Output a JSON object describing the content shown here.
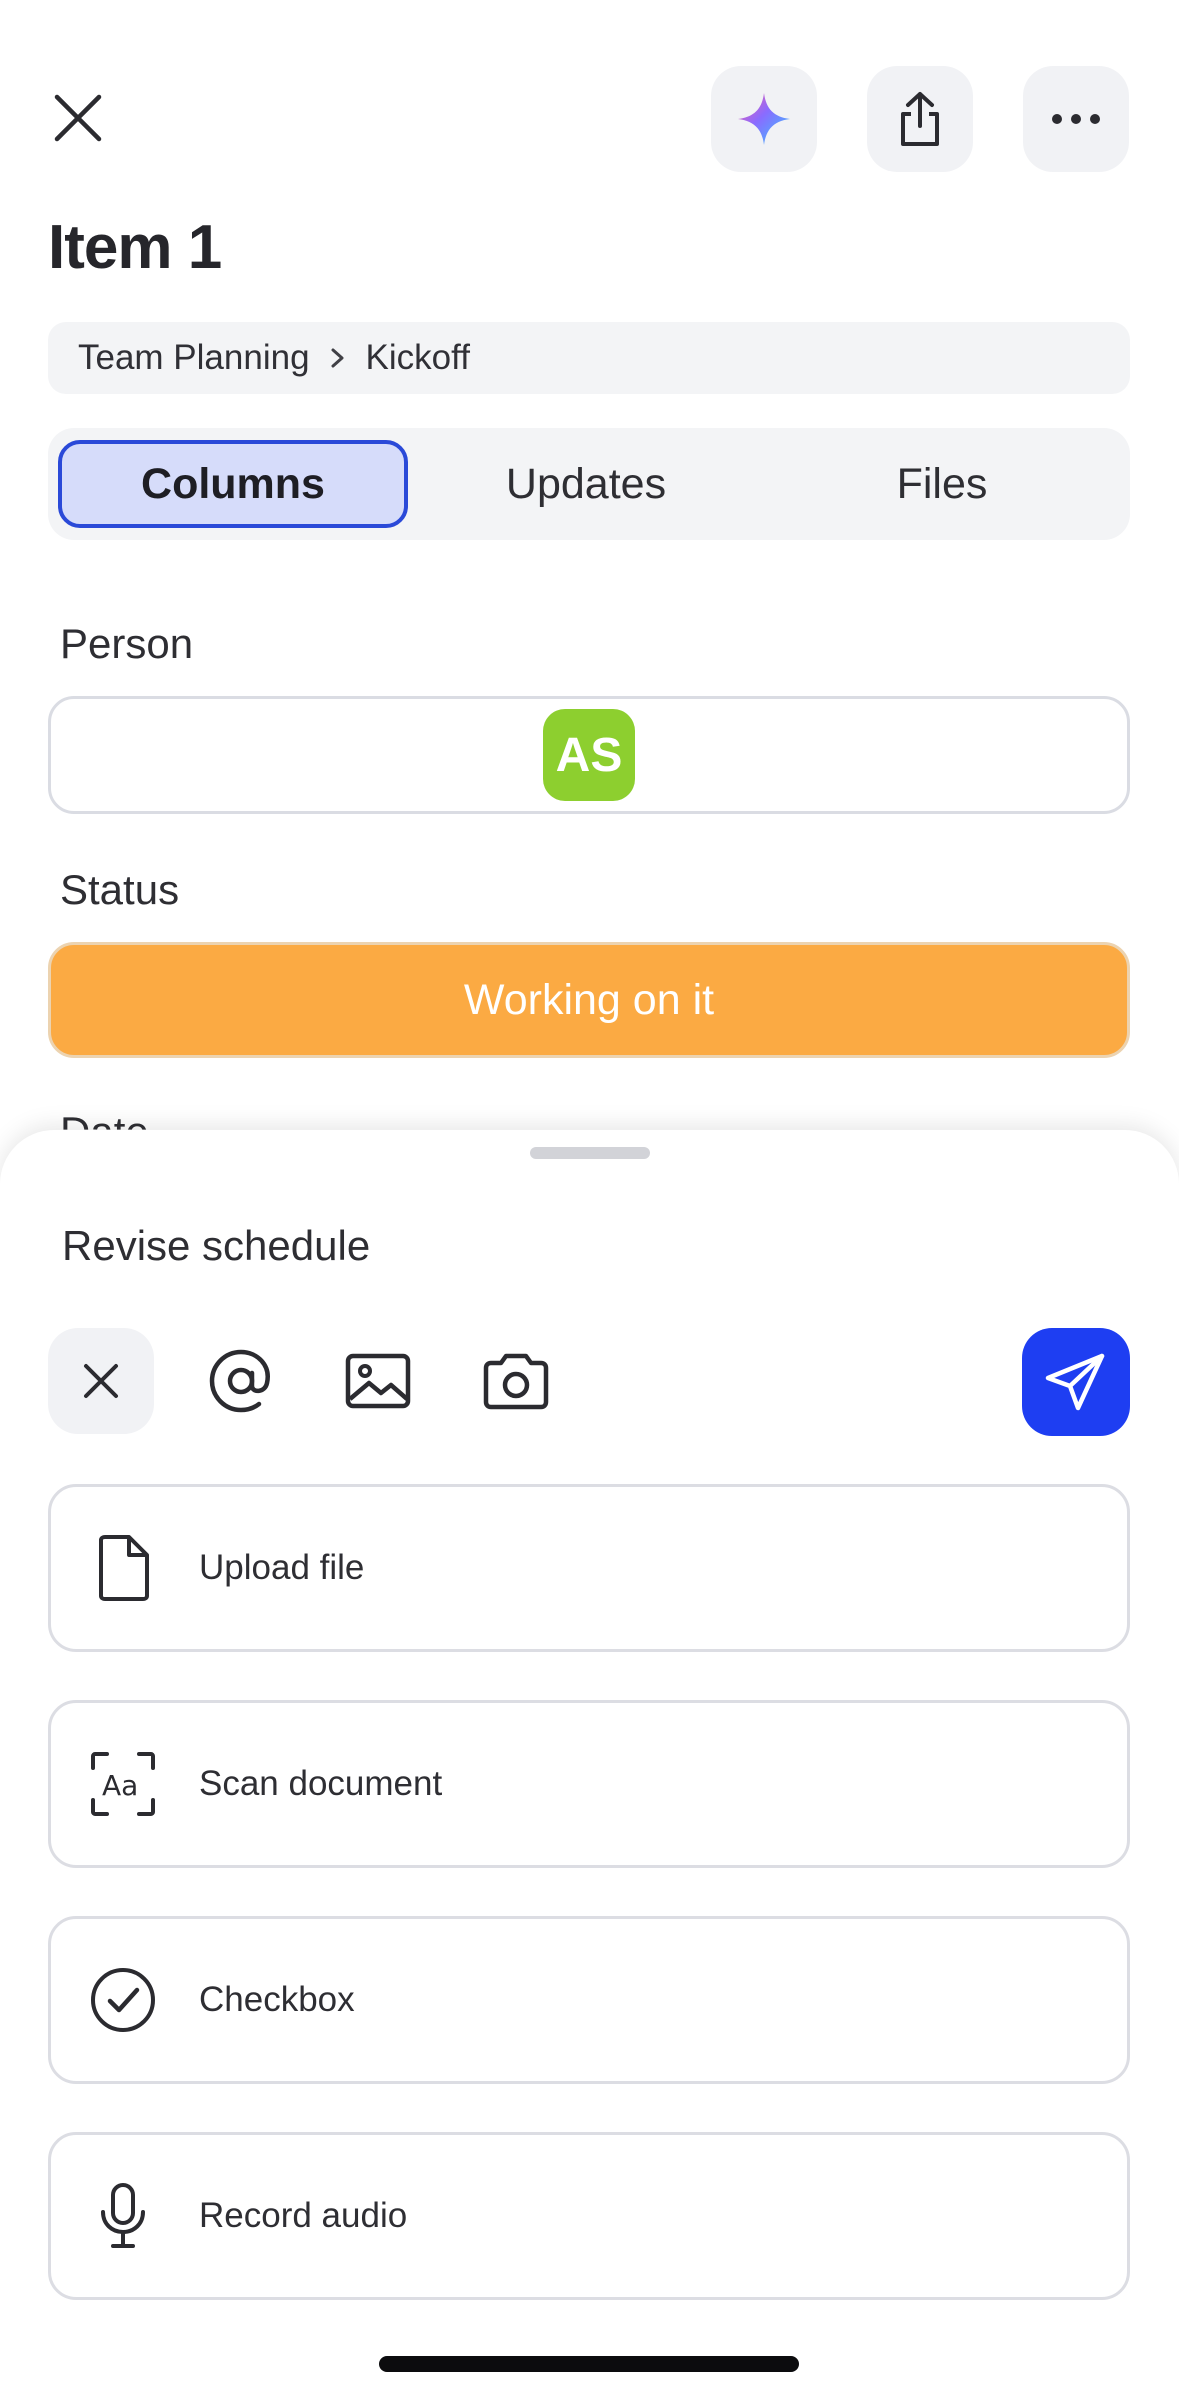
{
  "header": {
    "title": "Item 1",
    "icons": {
      "close": "close-icon",
      "ai": "sparkle-icon",
      "share": "share-icon",
      "more": "more-horizontal-icon"
    }
  },
  "breadcrumb": {
    "items": [
      "Team Planning",
      "Kickoff"
    ]
  },
  "tabs": [
    {
      "label": "Columns",
      "active": true
    },
    {
      "label": "Updates",
      "active": false
    },
    {
      "label": "Files",
      "active": false
    }
  ],
  "columns": {
    "person": {
      "label": "Person",
      "avatar_initials": "AS",
      "avatar_color": "#8dcf2f"
    },
    "status": {
      "label": "Status",
      "value": "Working on it",
      "color": "#fbaa43"
    },
    "date": {
      "label": "Date"
    }
  },
  "sheet": {
    "input_text": "Revise schedule",
    "toolbar": {
      "icons": [
        "close-icon",
        "mention-icon",
        "image-icon",
        "camera-icon"
      ],
      "send_icon": "send-icon",
      "send_color": "#1e3ef2"
    },
    "options": [
      {
        "label": "Upload file",
        "icon": "file-icon"
      },
      {
        "label": "Scan document",
        "icon": "scan-document-icon"
      },
      {
        "label": "Checkbox",
        "icon": "checkbox-icon"
      },
      {
        "label": "Record audio",
        "icon": "microphone-icon"
      }
    ]
  }
}
